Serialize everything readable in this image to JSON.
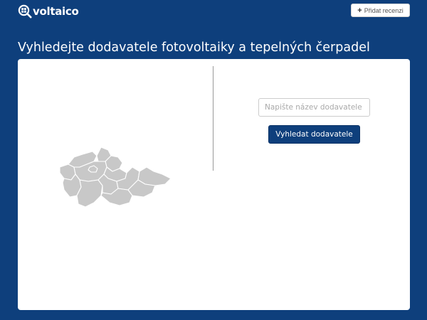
{
  "brand": {
    "logo_icon": "magnifier-solar-panel-icon",
    "name": "voltaico"
  },
  "header": {
    "add_review_icon": "plus-icon",
    "add_review_label": "Přidat recenzi"
  },
  "page": {
    "title": "Vyhledejte dodavatele fotovoltaiky a tepelných čerpadel"
  },
  "search": {
    "placeholder": "Napište název dodavatele",
    "value": "",
    "button_label": "Vyhledat dodavatele"
  },
  "map": {
    "region_icon": "czech-regions-map"
  },
  "colors": {
    "background": "#0e3f7c",
    "card": "#ffffff",
    "button": "#0e3f7c",
    "map_region": "#c8c8c8"
  }
}
